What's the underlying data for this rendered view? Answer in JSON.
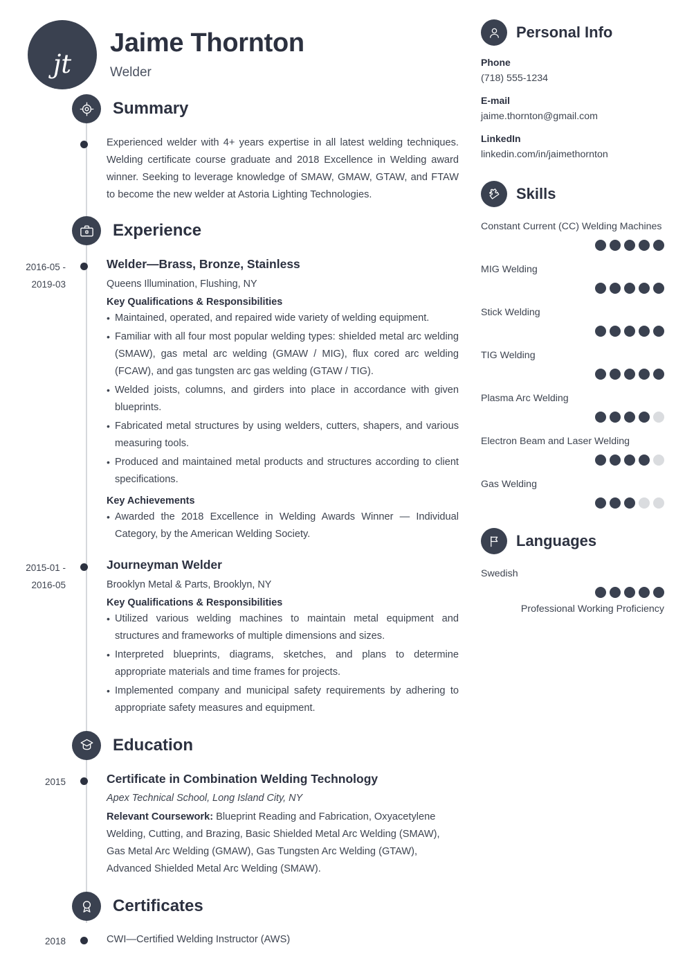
{
  "header": {
    "initials": "jt",
    "name": "Jaime Thornton",
    "job_title": "Welder"
  },
  "colors": {
    "accent_dark": "#3a4150",
    "text": "#3e4450",
    "muted_dot": "#dadcdf",
    "spine": "#d6d8dc"
  },
  "main": {
    "summary": {
      "icon": "target-icon",
      "title": "Summary",
      "text": "Experienced welder with 4+ years expertise in all latest welding techniques. Welding certificate course graduate and 2018 Excellence in Welding award winner. Seeking to leverage knowledge of SMAW, GMAW, GTAW, and FTAW to become the new welder at Astoria Lighting Technologies."
    },
    "experience": {
      "icon": "briefcase-icon",
      "title": "Experience",
      "entries": [
        {
          "date": "2016-05 - 2019-03",
          "date_line1": "2016-05 -",
          "date_line2": "2019-03",
          "title": "Welder—Brass, Bronze, Stainless",
          "company": "Queens Illumination, Flushing, NY",
          "qualifications_label": "Key Qualifications & Responsibilities",
          "qualifications": [
            "Maintained, operated, and repaired wide variety of welding equipment.",
            "Familiar with all four most popular welding types: shielded metal arc welding (SMAW), gas metal arc welding (GMAW / MIG), flux cored arc welding (FCAW), and gas tungsten arc gas welding (GTAW / TIG).",
            "Welded joists, columns, and girders into place in accordance with given blueprints.",
            "Fabricated metal structures by using welders, cutters, shapers, and various measuring tools.",
            "Produced and maintained metal products and structures according to client specifications."
          ],
          "achievements_label": "Key Achievements",
          "achievements": [
            "Awarded the 2018 Excellence in Welding Awards Winner — Individual Category, by the American Welding Society."
          ]
        },
        {
          "date": "2015-01 - 2016-05",
          "date_line1": "2015-01 -",
          "date_line2": "2016-05",
          "title": "Journeyman Welder",
          "company": "Brooklyn Metal & Parts, Brooklyn, NY",
          "qualifications_label": "Key Qualifications & Responsibilities",
          "qualifications": [
            "Utilized various welding machines to maintain metal equipment and structures and frameworks of multiple dimensions and sizes.",
            "Interpreted blueprints, diagrams, sketches, and plans to determine appropriate materials and time frames for projects.",
            "Implemented company and municipal safety requirements by adhering to appropriate safety measures and equipment."
          ]
        }
      ]
    },
    "education": {
      "icon": "graduation-cap-icon",
      "title": "Education",
      "entries": [
        {
          "date": "2015",
          "title": "Certificate in Combination Welding Technology",
          "school": "Apex Technical School, Long Island City, NY",
          "coursework_label": "Relevant Coursework:",
          "coursework": " Blueprint Reading and Fabrication, Oxyacetylene Welding, Cutting, and Brazing, Basic Shielded Metal Arc Welding (SMAW), Gas Metal Arc Welding (GMAW), Gas Tungsten Arc Welding (GTAW), Advanced Shielded Metal Arc Welding (SMAW)."
        }
      ]
    },
    "certificates": {
      "icon": "award-ribbon-icon",
      "title": "Certificates",
      "entries": [
        {
          "date": "2018",
          "text": "CWI—Certified Welding Instructor (AWS)"
        }
      ]
    }
  },
  "sidebar": {
    "personal_info": {
      "icon": "person-icon",
      "title": "Personal Info",
      "fields": [
        {
          "label": "Phone",
          "value": "(718) 555-1234"
        },
        {
          "label": "E-mail",
          "value": "jaime.thornton@gmail.com"
        },
        {
          "label": "LinkedIn",
          "value": "linkedin.com/in/jaimethornton"
        }
      ]
    },
    "skills": {
      "icon": "puzzle-piece-icon",
      "title": "Skills",
      "max_rating": 5,
      "items": [
        {
          "name": "Constant Current (CC) Welding Machines",
          "rating": 5
        },
        {
          "name": "MIG Welding",
          "rating": 5
        },
        {
          "name": "Stick Welding",
          "rating": 5
        },
        {
          "name": "TIG Welding",
          "rating": 5
        },
        {
          "name": "Plasma Arc Welding",
          "rating": 4
        },
        {
          "name": "Electron Beam and Laser Welding",
          "rating": 4
        },
        {
          "name": "Gas Welding",
          "rating": 3
        }
      ]
    },
    "languages": {
      "icon": "flag-icon",
      "title": "Languages",
      "max_rating": 5,
      "items": [
        {
          "name": "Swedish",
          "rating": 5,
          "note": "Professional Working Proficiency"
        }
      ]
    }
  }
}
